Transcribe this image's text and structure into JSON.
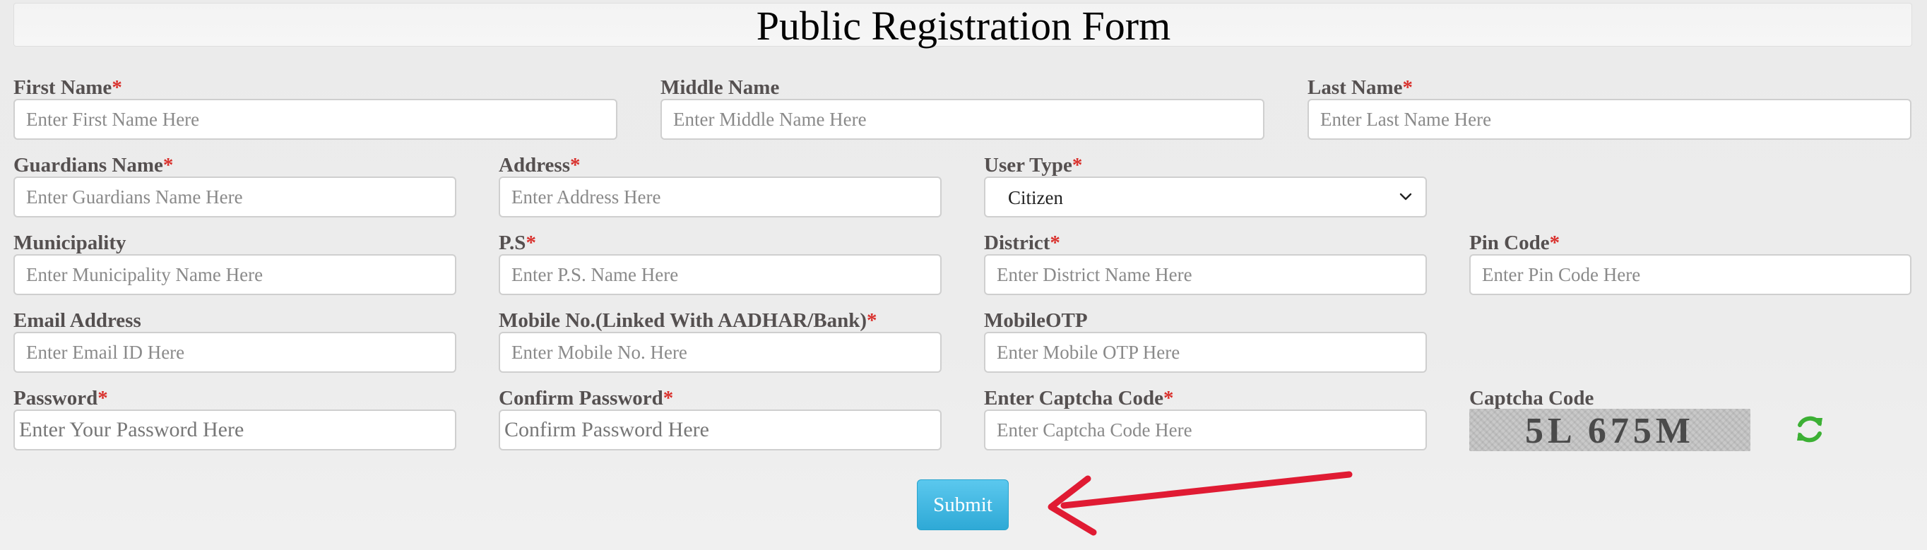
{
  "form": {
    "title": "Public Registration Form"
  },
  "fields": {
    "first_name": {
      "label": "First Name",
      "required": "*",
      "placeholder": "Enter First Name Here"
    },
    "middle_name": {
      "label": "Middle Name",
      "placeholder": "Enter Middle Name Here"
    },
    "last_name": {
      "label": "Last Name",
      "required": "*",
      "placeholder": "Enter Last Name Here"
    },
    "guardians_name": {
      "label": "Guardians Name",
      "required": "*",
      "placeholder": "Enter Guardians Name Here"
    },
    "address": {
      "label": "Address",
      "required": "*",
      "placeholder": "Enter Address Here"
    },
    "user_type": {
      "label": "User Type",
      "required": "*",
      "value": "Citizen"
    },
    "municipality": {
      "label": "Municipality",
      "placeholder": "Enter Municipality Name Here"
    },
    "ps": {
      "label": "P.S",
      "required": "*",
      "placeholder": "Enter P.S. Name Here"
    },
    "district": {
      "label": "District",
      "required": "*",
      "placeholder": "Enter District Name Here"
    },
    "pin_code": {
      "label": "Pin Code",
      "required": "*",
      "placeholder": "Enter Pin Code Here"
    },
    "email": {
      "label": "Email Address",
      "placeholder": "Enter Email ID Here"
    },
    "mobile": {
      "label": "Mobile No.(Linked With AADHAR/Bank)",
      "required": "*",
      "placeholder": "Enter Mobile No. Here"
    },
    "mobile_otp": {
      "label": "MobileOTP",
      "placeholder": "Enter Mobile OTP Here"
    },
    "password": {
      "label": "Password",
      "required": "*",
      "placeholder": "Enter Your Password Here"
    },
    "confirm_password": {
      "label": "Confirm Password",
      "required": "*",
      "placeholder": "Confirm Password Here"
    },
    "captcha_input": {
      "label": "Enter Captcha Code",
      "required": "*",
      "placeholder": "Enter Captcha Code Here"
    },
    "captcha": {
      "label": "Captcha Code",
      "text": "5L 675M"
    }
  },
  "actions": {
    "submit_label": "Submit"
  },
  "icons": {
    "refresh": "refresh-icon",
    "chevron": "chevron-down-icon",
    "annotation_arrow": "arrow-icon"
  },
  "colors": {
    "required": "#d9302c",
    "submit": "#2ea9d6",
    "refresh": "#3cb034",
    "annotation_arrow": "#e01b33"
  }
}
